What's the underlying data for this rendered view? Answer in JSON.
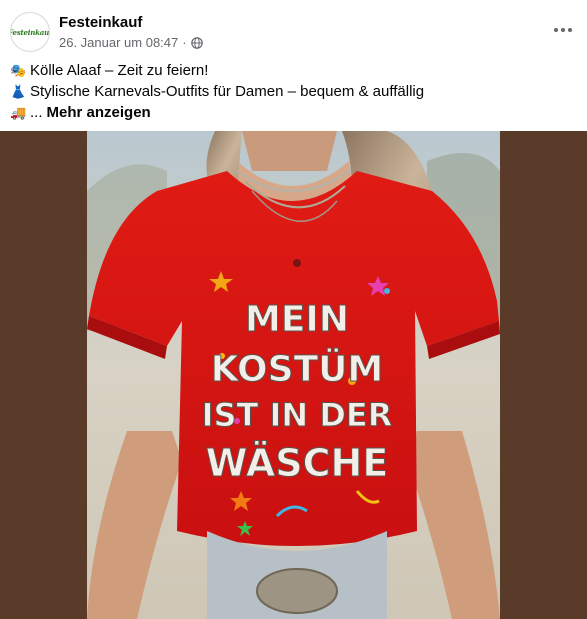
{
  "post": {
    "page_name": "Festeinkauf",
    "avatar_text": "Festeinkauf",
    "timestamp": "26. Januar um 08:47",
    "separator": "·",
    "privacy_icon": "globe-icon",
    "more_icon": "more-horizontal-icon"
  },
  "caption": {
    "line1_emoji": "🎭",
    "line1": "Kölle Alaaf – Zeit zu feiern!",
    "line2_emoji": "👗",
    "line2": "Stylische Karnevals-Outfits für Damen – bequem & auffällig",
    "line3_emoji": "🚚",
    "line3_prefix": "...",
    "more_label": "Mehr anzeigen"
  },
  "media": {
    "shirt_text": [
      "MEIN",
      "KOSTÜM",
      "IST IN DER",
      "WÄSCHE"
    ],
    "colors": {
      "shirt": "#d81313",
      "background": "#5a3b2a",
      "text": "#f3efe8"
    }
  }
}
